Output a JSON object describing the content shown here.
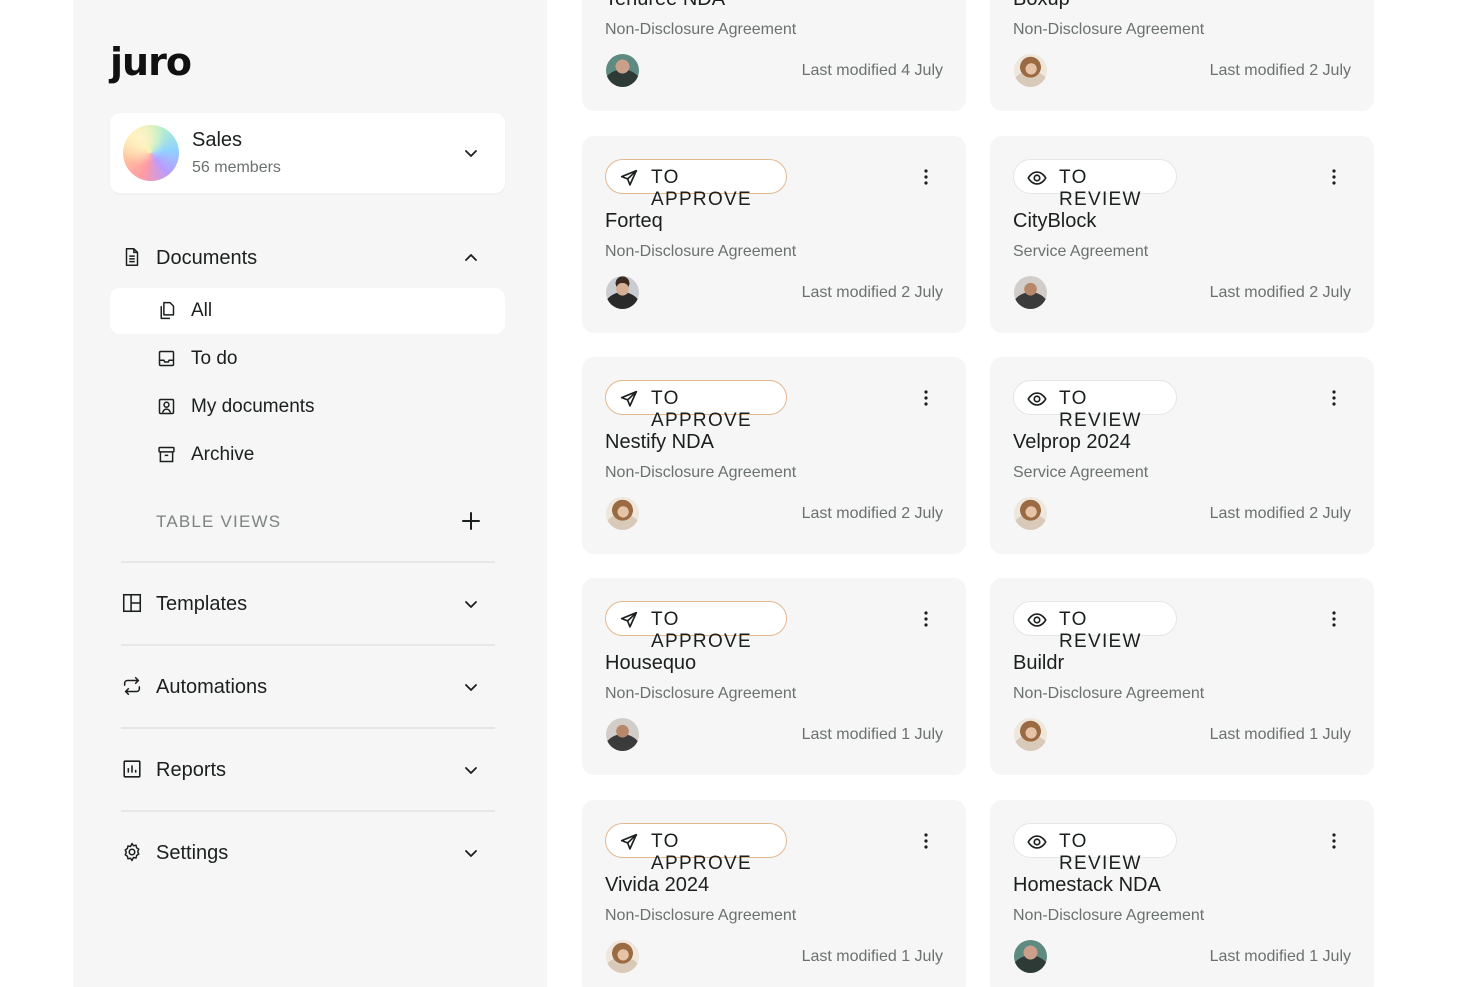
{
  "sidebar": {
    "logo": "juro",
    "team": {
      "name": "Sales",
      "members": "56 members"
    },
    "documents": {
      "label": "Documents",
      "items": [
        {
          "label": "All",
          "icon": "copy-icon",
          "active": true
        },
        {
          "label": "To do",
          "icon": "inbox-icon",
          "active": false
        },
        {
          "label": "My documents",
          "icon": "user-document-icon",
          "active": false
        },
        {
          "label": "Archive",
          "icon": "archive-icon",
          "active": false
        }
      ],
      "table_views_label": "TABLE VIEWS"
    },
    "sections": [
      {
        "label": "Templates",
        "icon": "layout-icon"
      },
      {
        "label": "Automations",
        "icon": "repeat-icon"
      },
      {
        "label": "Reports",
        "icon": "chart-icon"
      },
      {
        "label": "Settings",
        "icon": "gear-icon"
      }
    ]
  },
  "top_cards": [
    {
      "title": "Tenuree NDA",
      "type": "Non-Disclosure Agreement",
      "modified": "Last modified 4 July"
    },
    {
      "title": "Boxup",
      "type": "Non-Disclosure Agreement",
      "modified": "Last modified 2 July"
    }
  ],
  "cards": [
    {
      "status": "TO APPROVE",
      "status_kind": "approve",
      "title": "Forteq",
      "type": "Non-Disclosure Agreement",
      "modified": "Last modified 2 July"
    },
    {
      "status": "TO REVIEW",
      "status_kind": "review",
      "title": "CityBlock",
      "type": "Service Agreement",
      "modified": "Last modified 2 July"
    },
    {
      "status": "TO APPROVE",
      "status_kind": "approve",
      "title": "Nestify NDA",
      "type": "Non-Disclosure Agreement",
      "modified": "Last modified 2 July"
    },
    {
      "status": "TO REVIEW",
      "status_kind": "review",
      "title": "Velprop 2024",
      "type": "Service Agreement",
      "modified": "Last modified 2 July"
    },
    {
      "status": "TO APPROVE",
      "status_kind": "approve",
      "title": "Housequo",
      "type": "Non-Disclosure Agreement",
      "modified": "Last modified 1 July"
    },
    {
      "status": "TO REVIEW",
      "status_kind": "review",
      "title": "Buildr",
      "type": "Non-Disclosure Agreement",
      "modified": "Last modified 1 July"
    },
    {
      "status": "TO APPROVE",
      "status_kind": "approve",
      "title": "Vivida 2024",
      "type": "Non-Disclosure Agreement",
      "modified": "Last modified 1 July"
    },
    {
      "status": "TO REVIEW",
      "status_kind": "review",
      "title": "Homestack NDA",
      "type": "Non-Disclosure Agreement",
      "modified": "Last modified 1 July"
    }
  ],
  "colors": {
    "approve_border": "#e2b98f",
    "card_bg": "#f5f6f5",
    "sidebar_bg": "#f5f6f5"
  }
}
